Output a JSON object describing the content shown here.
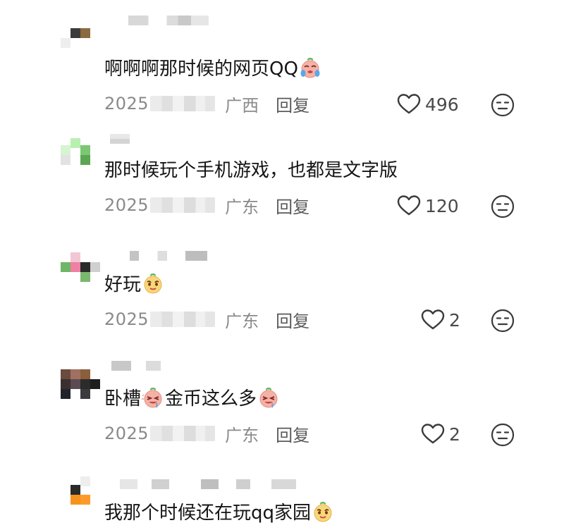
{
  "comments": [
    {
      "text": "啊啊啊那时候的网页QQ",
      "trailing_emoji": "crying-face-emoji",
      "year": "2025",
      "region": "广西",
      "reply": "回复",
      "likes": "496"
    },
    {
      "text": "那时候玩个手机游戏，也都是文字版",
      "year": "2025",
      "region": "广东",
      "reply": "回复",
      "likes": "120"
    },
    {
      "text": "好玩",
      "trailing_emoji": "smug-face-emoji",
      "year": "2025",
      "region": "广东",
      "reply": "回复",
      "likes": "2"
    },
    {
      "text_a": "卧槽",
      "text_b": "金币这么多",
      "inline_emoji": "drooling-face-emoji",
      "year": "2025",
      "region": "广东",
      "reply": "回复",
      "likes": "2"
    },
    {
      "text": "我那个时候还在玩qq家园",
      "trailing_emoji": "smug-face-emoji"
    }
  ],
  "colors": {
    "text": "#151515",
    "meta": "#8a8a8a",
    "icon": "#3a3a3a",
    "emoji_peach": "#f6b1a6",
    "emoji_yellow": "#f9d67a",
    "emoji_leaf": "#5fb85a"
  },
  "icons": {
    "like": "heart-outline-icon",
    "dislike": "neutral-face-icon"
  }
}
